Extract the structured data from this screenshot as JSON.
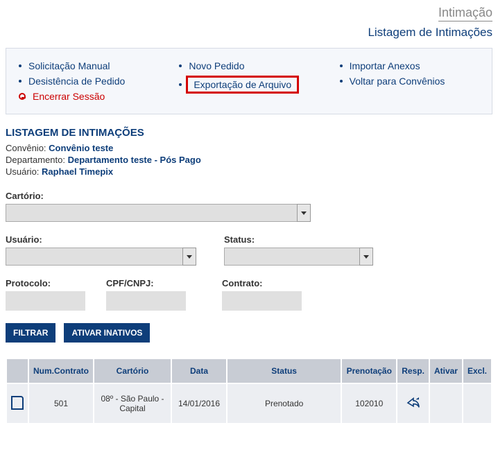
{
  "header": {
    "title": "Intimação"
  },
  "subtitle": "Listagem de Intimações",
  "nav": {
    "col1": [
      {
        "label": "Solicitação Manual",
        "key": "solicitacao-manual"
      },
      {
        "label": "Desistência de Pedido",
        "key": "desistencia-pedido"
      }
    ],
    "exit": {
      "label": "Encerrar Sessão"
    },
    "col2": [
      {
        "label": "Novo Pedido",
        "key": "novo-pedido"
      },
      {
        "label": "Exportação de Arquivo",
        "key": "exportacao-arquivo",
        "highlight": true
      }
    ],
    "col3": [
      {
        "label": "Importar Anexos",
        "key": "importar-anexos"
      },
      {
        "label": "Voltar para Convênios",
        "key": "voltar-convenios"
      }
    ]
  },
  "section": {
    "title": "LISTAGEM DE INTIMAÇÕES",
    "convenio_label": "Convênio:",
    "convenio_value": "Convênio teste",
    "depto_label": "Departamento:",
    "depto_value": "Departamento teste - Pós Pago",
    "usuario_label": "Usuário:",
    "usuario_value": "Raphael Timepix"
  },
  "filters": {
    "cartorio_label": "Cartório:",
    "usuario_label": "Usuário:",
    "status_label": "Status:",
    "protocolo_label": "Protocolo:",
    "cpfcnpj_label": "CPF/CNPJ:",
    "contrato_label": "Contrato:"
  },
  "buttons": {
    "filtrar": "FILTRAR",
    "ativar": "ATIVAR INATIVOS"
  },
  "table": {
    "headers": {
      "blank": "",
      "numcontrato": "Num.Contrato",
      "cartorio": "Cartório",
      "data": "Data",
      "status": "Status",
      "prenotacao": "Prenotação",
      "resp": "Resp.",
      "ativar": "Ativar",
      "excl": "Excl."
    },
    "rows": [
      {
        "numcontrato": "501",
        "cartorio": "08º - São Paulo - Capital",
        "data": "14/01/2016",
        "status": "Prenotado",
        "prenotacao": "102010"
      }
    ]
  }
}
